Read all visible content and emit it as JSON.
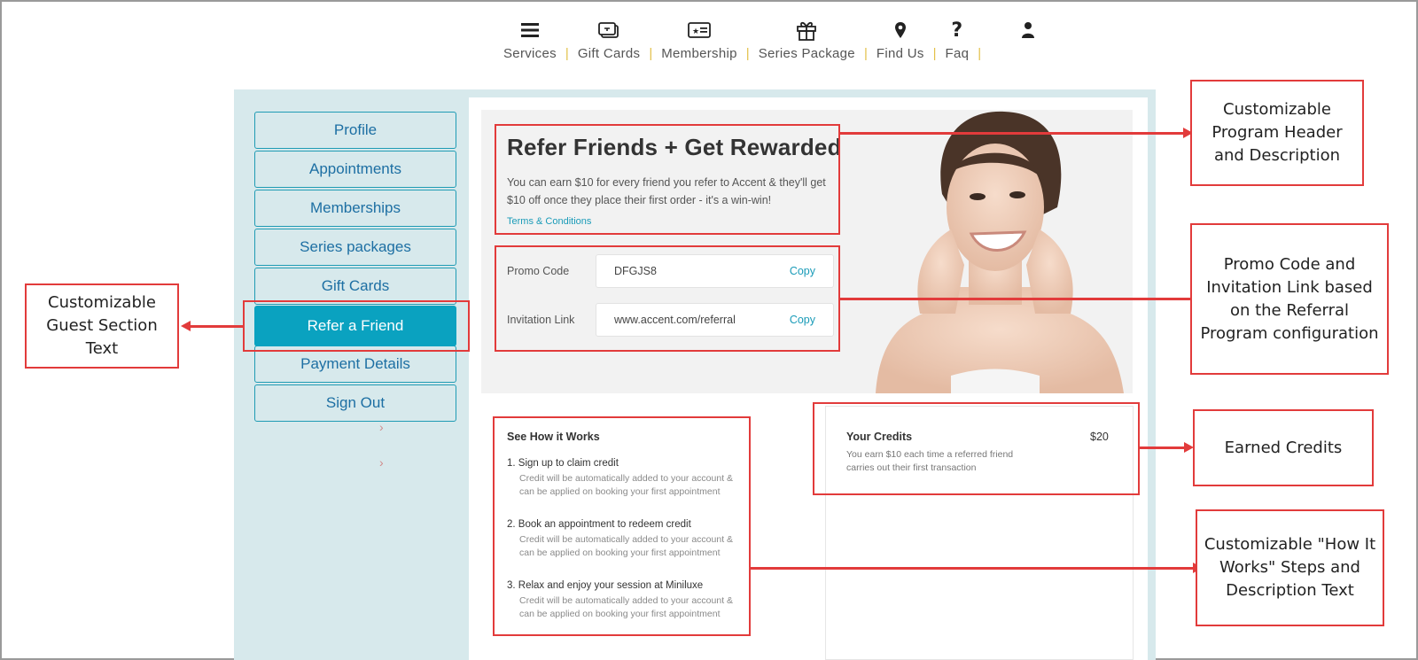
{
  "nav": {
    "items": [
      {
        "label": "Services",
        "icon": "menu-icon"
      },
      {
        "label": "Gift Cards",
        "icon": "gift-card-icon"
      },
      {
        "label": "Membership",
        "icon": "membership-card-icon"
      },
      {
        "label": "Series Package",
        "icon": "gift-box-icon"
      },
      {
        "label": "Find Us",
        "icon": "map-pin-icon"
      },
      {
        "label": "Faq",
        "icon": "question-icon"
      }
    ],
    "separator": "|",
    "account_icon": "user-icon"
  },
  "sidebar": {
    "items": [
      {
        "label": "Profile"
      },
      {
        "label": "Appointments"
      },
      {
        "label": "Memberships"
      },
      {
        "label": "Series packages"
      },
      {
        "label": "Gift Cards"
      },
      {
        "label": "Refer a Friend"
      },
      {
        "label": "Payment Details"
      },
      {
        "label": "Sign Out"
      }
    ],
    "active": "Refer a Friend",
    "chevron": "›"
  },
  "referral": {
    "title": "Refer Friends + Get Rewarded",
    "description": "You can earn $10 for every friend you refer to Accent & they'll get $10 off once they place their first order - it's a win-win!",
    "terms": "Terms & Conditions",
    "promo_label": "Promo Code",
    "promo_code": "DFGJS8",
    "invite_label": "Invitation Link",
    "invite_link": "www.accent.com/referral",
    "copy_label": "Copy"
  },
  "how_it_works": {
    "title": "See How it Works",
    "steps": [
      {
        "title": "1. Sign up to claim credit",
        "desc": "Credit will be automatically added to your account & can be applied on booking your first appointment"
      },
      {
        "title": "2. Book an appointment to redeem credit",
        "desc": "Credit will be automatically added to your account & can be applied on booking your first appointment"
      },
      {
        "title": "3. Relax and enjoy your session at Miniluxe",
        "desc": "Credit will be automatically added to your account & can be applied on booking your first appointment"
      }
    ]
  },
  "credits": {
    "title": "Your Credits",
    "amount": "$20",
    "desc": "You earn $10 each time a referred friend carries out their first transaction"
  },
  "annotations": {
    "header": "Customizable Program Header and Description",
    "promo": "Promo Code and Invitation Link based on the Referral Program configuration",
    "credits": "Earned Credits",
    "how": "Customizable \"How It Works\" Steps and Description Text",
    "guest": "Customizable Guest Section Text"
  },
  "colors": {
    "accent": "#0aa2c0",
    "panel_bg": "#d7e9ec",
    "link": "#1a9bb8",
    "annotation": "#e23b3b",
    "nav_separator": "#e3c14a"
  }
}
